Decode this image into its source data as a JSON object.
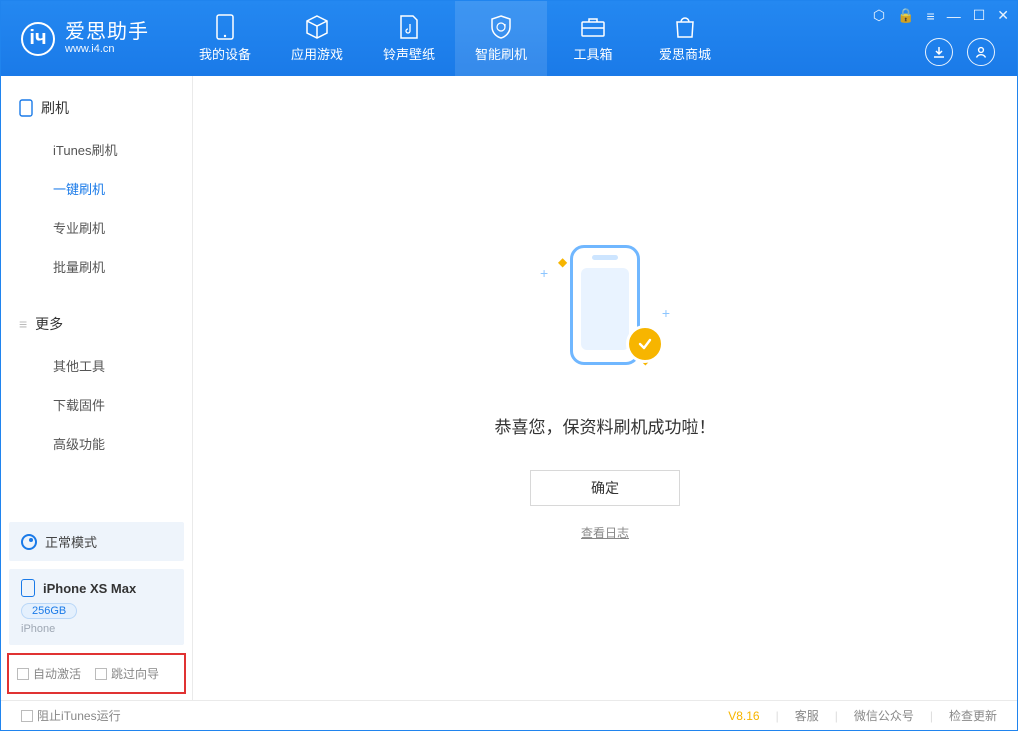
{
  "app": {
    "title": "爱思助手",
    "url": "www.i4.cn"
  },
  "nav": {
    "items": [
      {
        "label": "我的设备"
      },
      {
        "label": "应用游戏"
      },
      {
        "label": "铃声壁纸"
      },
      {
        "label": "智能刷机"
      },
      {
        "label": "工具箱"
      },
      {
        "label": "爱思商城"
      }
    ]
  },
  "sidebar": {
    "section1": {
      "title": "刷机",
      "items": [
        "iTunes刷机",
        "一键刷机",
        "专业刷机",
        "批量刷机"
      ]
    },
    "section2": {
      "title": "更多",
      "items": [
        "其他工具",
        "下载固件",
        "高级功能"
      ]
    },
    "mode": "正常模式",
    "device": {
      "name": "iPhone XS Max",
      "storage": "256GB",
      "type": "iPhone"
    },
    "checks": {
      "auto_activate": "自动激活",
      "skip_guide": "跳过向导"
    }
  },
  "main": {
    "message": "恭喜您，保资料刷机成功啦！",
    "ok": "确定",
    "view_log": "查看日志"
  },
  "statusbar": {
    "block_itunes": "阻止iTunes运行",
    "version": "V8.16",
    "links": [
      "客服",
      "微信公众号",
      "检查更新"
    ]
  }
}
